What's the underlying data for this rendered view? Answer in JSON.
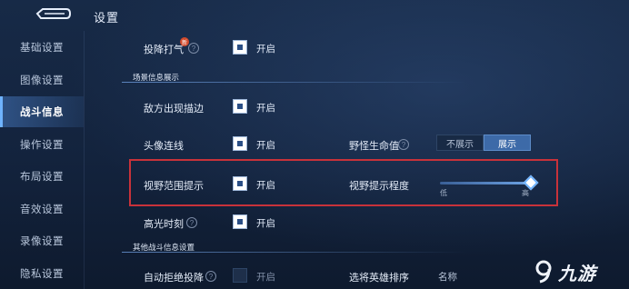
{
  "header": {
    "title": "设置",
    "back_icon": "back-arrow-icon"
  },
  "sidebar": {
    "items": [
      {
        "label": "基础设置",
        "active": false
      },
      {
        "label": "图像设置",
        "active": false
      },
      {
        "label": "战斗信息",
        "active": true
      },
      {
        "label": "操作设置",
        "active": false
      },
      {
        "label": "布局设置",
        "active": false
      },
      {
        "label": "音效设置",
        "active": false
      },
      {
        "label": "录像设置",
        "active": false
      },
      {
        "label": "隐私设置",
        "active": false
      }
    ]
  },
  "settings": {
    "surrender": {
      "label": "投降打气",
      "badge": "新",
      "value": "开启",
      "checked": true
    },
    "section_scene": "场景信息展示",
    "enemy_stroke": {
      "label": "敌方出现描边",
      "checked": true
    },
    "avatar_link": {
      "label": "头像连线",
      "value": "开启",
      "checked": true
    },
    "monster_hp": {
      "label": "野怪生命值",
      "options": [
        "不展示",
        "展示"
      ],
      "selected": "展示"
    },
    "vision_hint": {
      "label": "视野范围提示",
      "value": "开启",
      "checked": true
    },
    "vision_level": {
      "label": "视野提示程度",
      "min_label": "低",
      "max_label": "高",
      "level": 1.0
    },
    "highlight_moment": {
      "label": "高光时刻",
      "value": "开启",
      "checked": true
    },
    "section_other": "其他战斗信息设置",
    "auto_reject": {
      "label": "自动拒绝投降",
      "value": "开启",
      "checked": false
    },
    "hero_sort": {
      "label": "选将英雄排序",
      "value": "名称"
    }
  },
  "watermark": {
    "text": "九游"
  },
  "colors": {
    "accent": "#3d6aa8",
    "highlight_border": "#c8323a",
    "sidebar_active": "#6fb3ff"
  }
}
